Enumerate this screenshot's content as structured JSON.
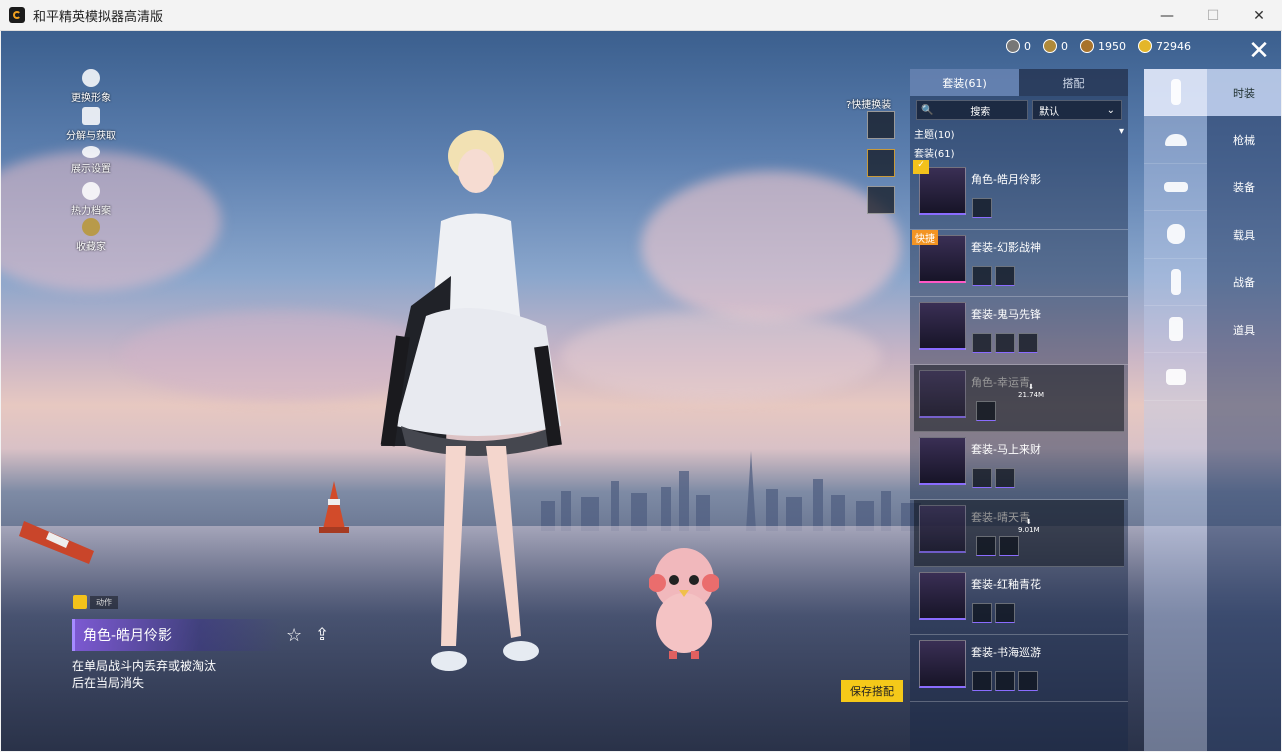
{
  "window": {
    "title": "和平精英模拟器高清版",
    "minimize": "—",
    "maximize": "☐",
    "close": "✕"
  },
  "currency": [
    {
      "icon": "coin-silver-icon",
      "value": "0"
    },
    {
      "icon": "coin-gold-icon",
      "value": "0"
    },
    {
      "icon": "coin-bronze-icon",
      "value": "1950"
    },
    {
      "icon": "coin-yellow-icon",
      "value": "72946"
    }
  ],
  "left_menu": [
    {
      "label": "更换形象",
      "icon": "avatar-icon"
    },
    {
      "label": "分解与获取",
      "icon": "puzzle-icon"
    },
    {
      "label": "展示设置",
      "icon": "eye-icon"
    },
    {
      "label": "热力档案",
      "icon": "flame-icon"
    },
    {
      "label": "收藏家",
      "icon": "badge-icon"
    }
  ],
  "quick_swap": {
    "label": "?快捷换装"
  },
  "panel": {
    "tab_outfit": "套装(61)",
    "tab_match": "搭配",
    "search_placeholder": "搜索",
    "sort": "默认",
    "theme_section": "主题(10)",
    "outfit_section": "套装(61)",
    "items": [
      {
        "name": "角色-皓月伶影",
        "tag": "",
        "download": "",
        "subs": 1
      },
      {
        "name": "套装-幻影战神",
        "tag": "快捷",
        "download": "",
        "subs": 2
      },
      {
        "name": "套装-鬼马先锋",
        "tag": "",
        "download": "",
        "subs": 3
      },
      {
        "name": "角色-幸运青",
        "tag": "",
        "download": "21.74M",
        "subs": 1
      },
      {
        "name": "套装-马上来财",
        "tag": "",
        "download": "",
        "subs": 2
      },
      {
        "name": "套装-晴天青",
        "tag": "",
        "download": "9.01M",
        "subs": 2
      },
      {
        "name": "套装-红釉青花",
        "tag": "",
        "download": "",
        "subs": 2
      },
      {
        "name": "套装-书海巡游",
        "tag": "",
        "download": "",
        "subs": 3
      }
    ]
  },
  "categories": [
    "时装",
    "枪械",
    "装备",
    "载具",
    "战备",
    "道具"
  ],
  "category_icons": [
    "character-icon",
    "cap-icon",
    "goggles-icon",
    "mask-icon",
    "outfit-icon",
    "pants-icon",
    "shoes-icon"
  ],
  "selected": {
    "action_tag": "动作",
    "title": "角色-皓月伶影",
    "description": "在单局战斗内丢弃或被淘汰后在当局消失"
  },
  "save_button": "保存搭配",
  "colors": {
    "accent": "#f5c919",
    "highlight": "#8a6cff",
    "quick_tag": "#f39423"
  }
}
